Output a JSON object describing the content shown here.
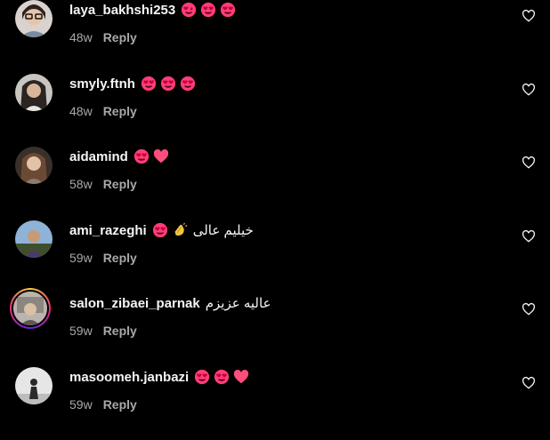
{
  "comments": [
    {
      "username": "laya_bakhshi253",
      "text": "",
      "time": "48w",
      "reply_label": "Reply",
      "emojis": [
        "heart-eyes",
        "heart-eyes",
        "heart-eyes"
      ]
    },
    {
      "username": "smyly.ftnh",
      "text": "",
      "time": "48w",
      "reply_label": "Reply",
      "emojis": [
        "heart-eyes",
        "heart-eyes",
        "heart-eyes"
      ]
    },
    {
      "username": "aidamind",
      "text": "",
      "time": "58w",
      "reply_label": "Reply",
      "emojis": [
        "heart-eyes",
        "pink-heart"
      ]
    },
    {
      "username": "ami_razeghi",
      "text": "خیلیم عالی",
      "time": "59w",
      "reply_label": "Reply",
      "emojis": [
        "heart-eyes",
        "clapping-hands"
      ]
    },
    {
      "username": "salon_zibaei_parnak",
      "text": "عالیه عزیزم",
      "time": "59w",
      "reply_label": "Reply",
      "emojis": []
    },
    {
      "username": "masoomeh.janbazi",
      "text": "",
      "time": "59w",
      "reply_label": "Reply",
      "emojis": [
        "heart-eyes",
        "heart-eyes",
        "pink-heart"
      ]
    }
  ],
  "icons": {
    "like": "heart-outline-icon"
  },
  "colors": {
    "background": "#000000",
    "primary_text": "#f5f5f5",
    "secondary_text": "#a8a8a8",
    "emoji_pink": "#ff3d77"
  }
}
